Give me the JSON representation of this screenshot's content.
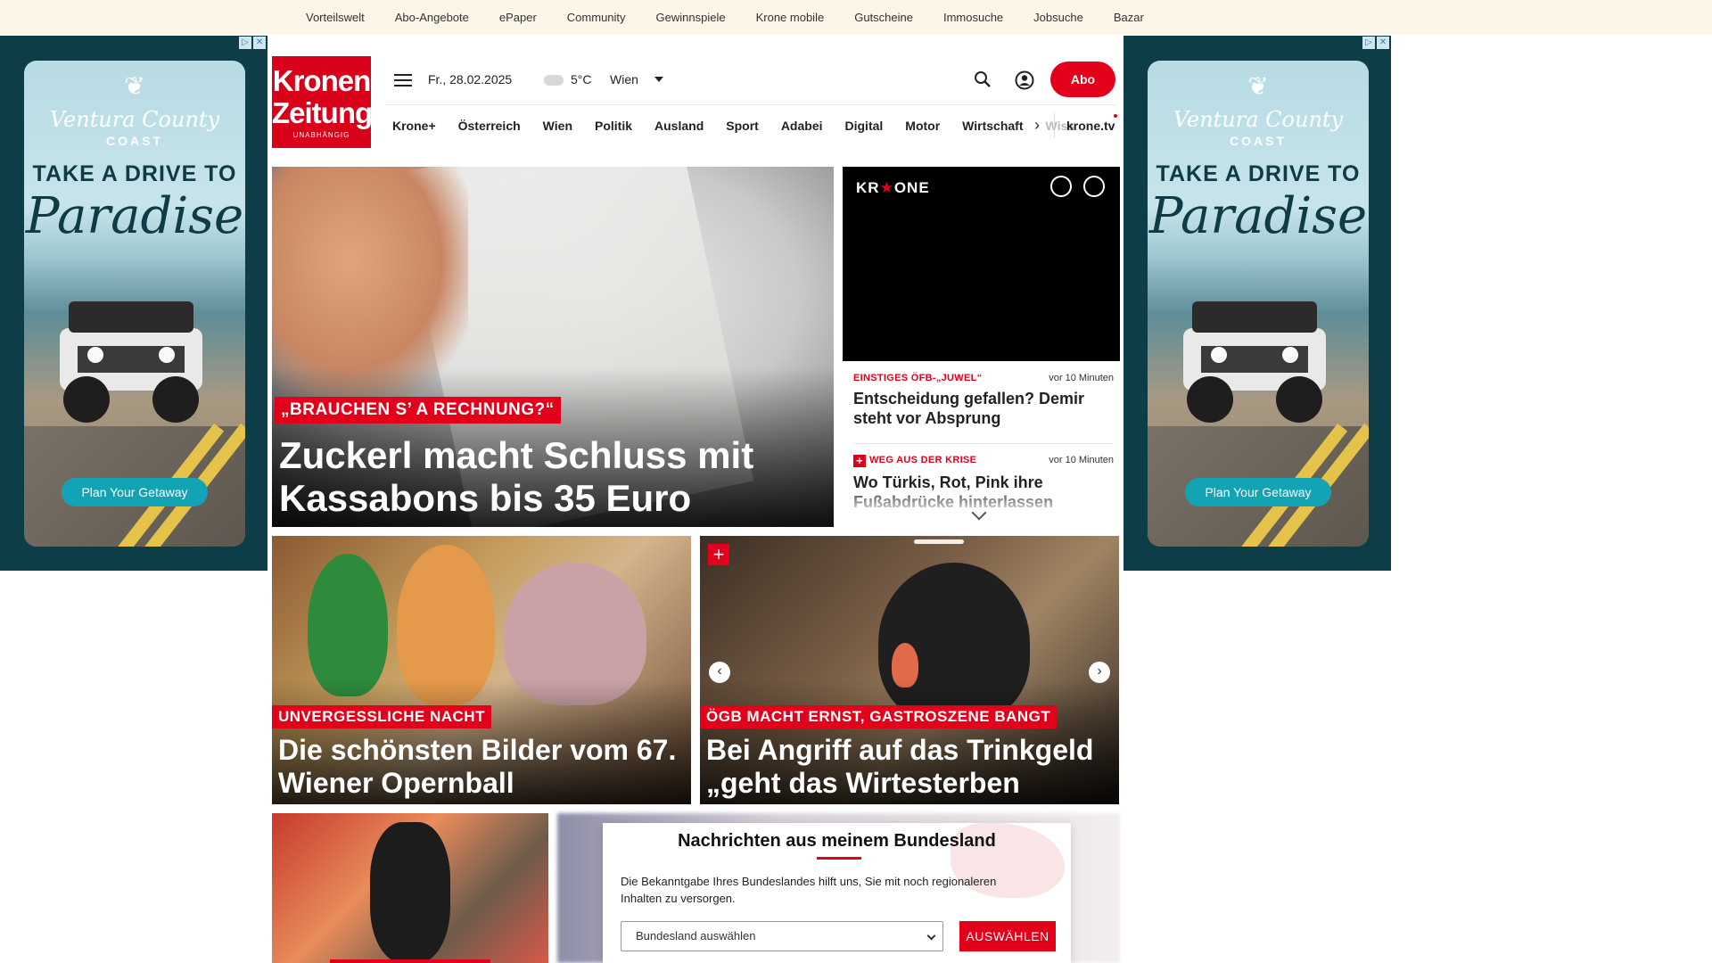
{
  "topbar": {
    "items": [
      "Vorteilswelt",
      "Abo-Angebote",
      "ePaper",
      "Community",
      "Gewinnspiele",
      "Krone mobile",
      "Gutscheine",
      "Immosuche",
      "Jobsuche",
      "Bazar"
    ]
  },
  "ads": {
    "brand_line1": "Ventura County",
    "brand_line2": "COAST",
    "headline1": "TAKE A DRIVE TO",
    "headline2": "Paradise",
    "cta": "Plan Your Getaway",
    "accent_color": "#12a3b5"
  },
  "header": {
    "logo_line1": "Kronen",
    "logo_line2": "Zeitung",
    "logo_line3": "UNABHÄNGIG",
    "date": "Fr., 28.02.2025",
    "temperature": "5°C",
    "region": "Wien",
    "abo_label": "Abo",
    "brand_color": "#e2001a"
  },
  "nav": {
    "items": [
      "Krone+",
      "Österreich",
      "Wien",
      "Politik",
      "Ausland",
      "Sport",
      "Adabei",
      "Digital",
      "Motor",
      "Wirtschaft"
    ],
    "faded": "Wiss",
    "tv": "krone.tv"
  },
  "hero": {
    "kicker": "„BRAUCHEN S’ A RECHNUNG?“",
    "headline": "Zuckerl macht Schluss mit Kassabons bis 35 Euro"
  },
  "tv": {
    "logo_pre": "KR",
    "logo_mark": "★",
    "logo_post": "ONE"
  },
  "ticker": [
    {
      "kicker": "EINSTIGES ÖFB-„JUWEL“",
      "time": "vor 10 Minuten",
      "headline": "Entscheidung gefallen? Demir steht vor Absprung",
      "plus": false
    },
    {
      "kicker": "WEG AUS DER KRISE",
      "time": "vor 10 Minuten",
      "headline": "Wo Türkis, Rot, Pink ihre Fußabdrücke hinterlassen",
      "plus": true
    }
  ],
  "tiles": [
    {
      "kicker": "UNVERGESSLICHE NACHT",
      "headline": "Die schönsten Bilder vom 67. Wiener Opernball"
    },
    {
      "kicker": "ÖGB MACHT ERNST, GASTROSZENE BANGT",
      "headline": "Bei Angriff auf das Trinkgeld „geht das Wirtesterben weiter“"
    }
  ],
  "modal": {
    "title": "Nachrichten aus meinem Bundesland",
    "text": "Die Bekanntgabe Ihres Bundeslandes hilft uns, Sie mit noch regionaleren Inhalten zu versorgen.",
    "select_placeholder": "Bundesland auswählen",
    "button": "AUSWÄHLEN"
  }
}
